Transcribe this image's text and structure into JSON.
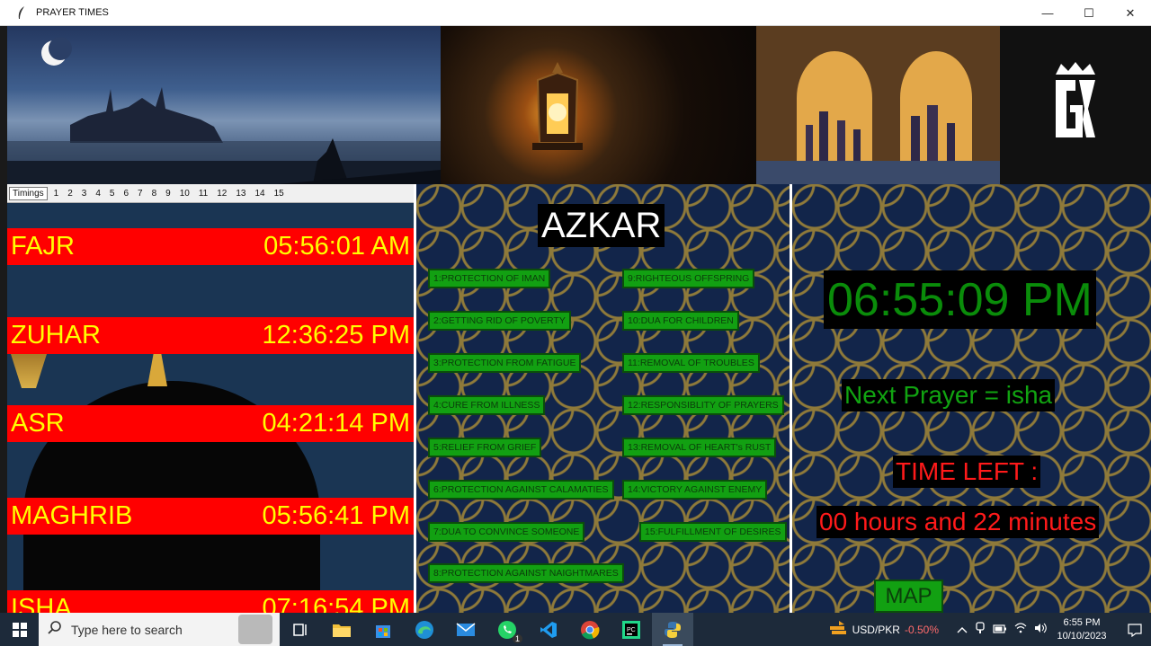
{
  "window": {
    "title": "PRAYER TIMES",
    "controls": {
      "minimize": "—",
      "maximize": "☐",
      "close": "✕"
    }
  },
  "tabs": [
    "Timings",
    "1",
    "2",
    "3",
    "4",
    "5",
    "6",
    "7",
    "8",
    "9",
    "10",
    "11",
    "12",
    "13",
    "14",
    "15"
  ],
  "prayers": [
    {
      "name": "FAJR",
      "time": "05:56:01 AM"
    },
    {
      "name": "ZUHAR",
      "time": "12:36:25 PM"
    },
    {
      "name": "ASR",
      "time": "04:21:14 PM"
    },
    {
      "name": "MAGHRIB",
      "time": "05:56:41 PM"
    },
    {
      "name": "ISHA",
      "time": "07:16:54 PM"
    }
  ],
  "azkar": {
    "title": "AZKAR",
    "buttons": [
      "1:PROTECTION OF IMAN",
      "2:GETTING RID OF POVERTY",
      "3:PROTECTION FROM FATIGUE",
      "4:CURE FROM ILLNESS",
      "5:RELIEF FROM GRIEF",
      "6:PROTECTION AGAINST CALAMATIES",
      "7:DUA TO CONVINCE SOMEONE",
      "8:PROTECTION AGAINST NAIGHTMARES",
      "9:RIGHTEOUS OFFSPRING",
      "10:DUA FOR CHILDREN",
      "11:REMOVAL OF TROUBLES",
      "12:RESPONSIBLITY OF PRAYERS",
      "13:REMOVAL OF HEART's RUST",
      "14:VICTORY AGAINST ENEMY",
      "15:FULFILLMENT OF DESIRES"
    ]
  },
  "status": {
    "clock": "06:55:09 PM",
    "next_prayer": "Next Prayer = isha",
    "time_left_label": "TIME LEFT :",
    "time_left_value": "00 hours and 22 minutes",
    "map_button": "MAP"
  },
  "taskbar": {
    "search_placeholder": "Type here to search",
    "ticker_pair": "USD/PKR",
    "ticker_change": "-0.50%",
    "time": "6:55 PM",
    "date": "10/10/2023",
    "whatsapp_badge": "1"
  },
  "colors": {
    "prayer_bar": "#ff0000",
    "prayer_text": "#ffff00",
    "azkar_button": "#12a012",
    "clock_text": "#0a8c0a",
    "time_left_text": "#ff1a1a"
  }
}
